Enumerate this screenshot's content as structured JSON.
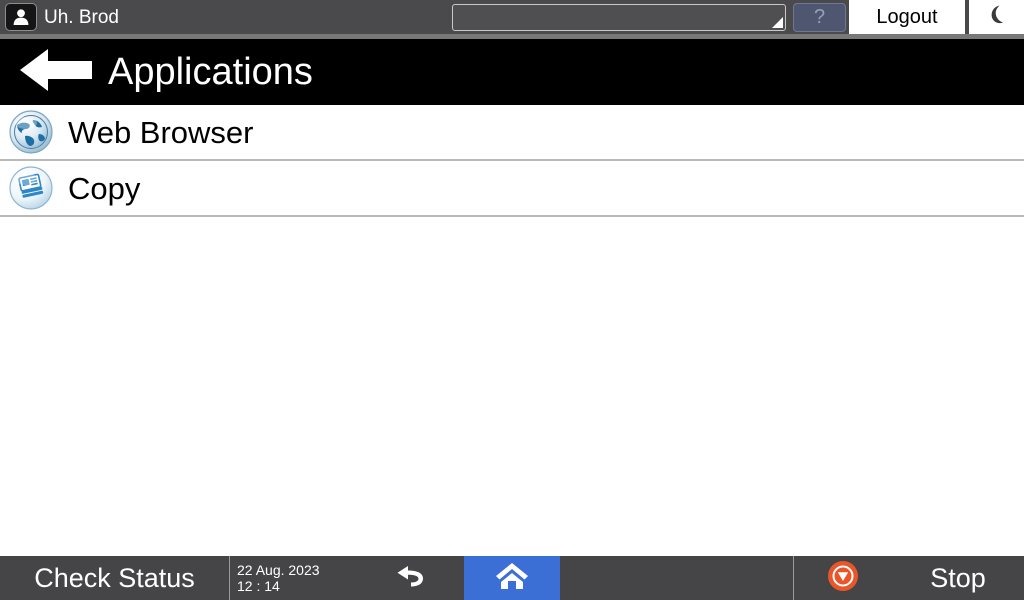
{
  "topbar": {
    "user_icon": "user-icon",
    "user_name": "Uh. Brod",
    "combo_value": "",
    "combo_placeholder": "",
    "help_label": "?",
    "logout_label": "Logout",
    "moon_icon": "moon-icon",
    "colors": {
      "bar_bg": "#4a4a4c",
      "help_bg": "#4e5670",
      "help_fg": "#9aa0b2"
    }
  },
  "titlebar": {
    "back_icon": "back-arrow-icon",
    "title": "Applications",
    "bg": "#000000"
  },
  "applications": {
    "items": [
      {
        "label": "Web Browser",
        "icon": "globe-icon"
      },
      {
        "label": "Copy",
        "icon": "copy-document-icon"
      }
    ]
  },
  "bottombar": {
    "check_status_label": "Check Status",
    "date": "22 Aug. 2023",
    "time": "12 : 14",
    "undo_icon": "undo-arrow-icon",
    "home_icon": "home-icon",
    "stop_icon": "stop-icon",
    "stop_label": "Stop",
    "colors": {
      "bar_bg": "#454547",
      "home_bg": "#3c6fd6",
      "stop_bg": "#e8562a"
    }
  }
}
